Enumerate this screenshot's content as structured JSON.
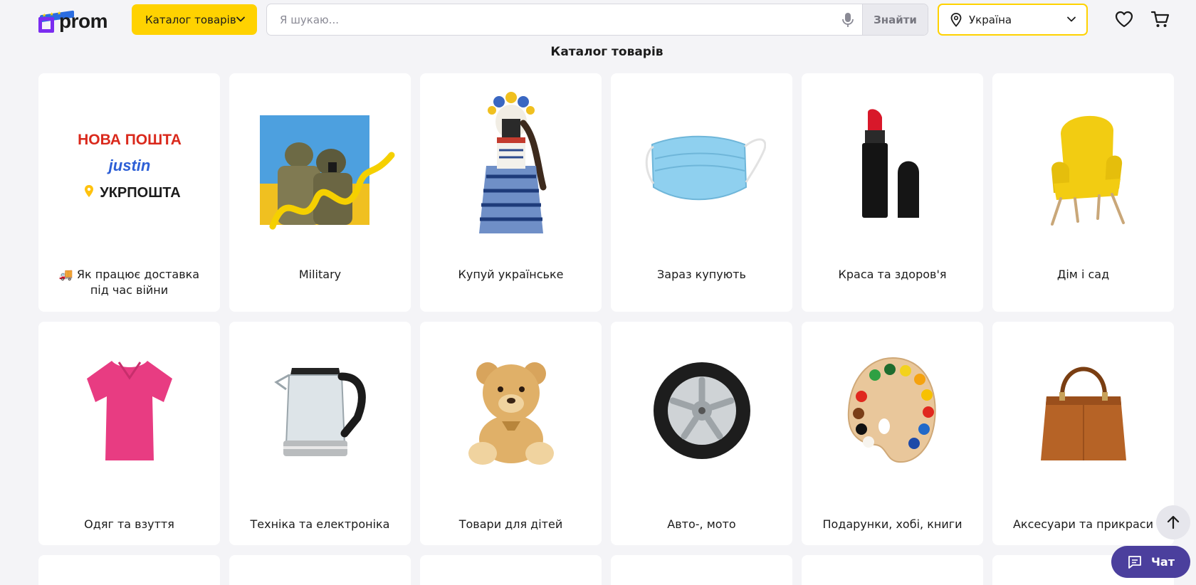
{
  "header": {
    "logo_text": "prom",
    "catalog_button_label": "Каталог товарів",
    "search": {
      "placeholder": "Я шукаю...",
      "value": "",
      "button_label": "Знайти"
    },
    "region": {
      "selected": "Україна"
    }
  },
  "page_title": "Каталог товарів",
  "categories": [
    {
      "label": "🚚 Як працює доставка під час війни",
      "icon": "delivery-logos-image"
    },
    {
      "label": "Military",
      "icon": "military-image"
    },
    {
      "label": "Купуй українське",
      "icon": "motanka-doll-image"
    },
    {
      "label": "Зараз купують",
      "icon": "face-mask-image"
    },
    {
      "label": "Краса та здоров'я",
      "icon": "lipstick-image"
    },
    {
      "label": "Дім і сад",
      "icon": "armchair-image"
    },
    {
      "label": "Одяг та взуття",
      "icon": "t-shirt-image"
    },
    {
      "label": "Техніка та електроніка",
      "icon": "kettle-image"
    },
    {
      "label": "Товари для дітей",
      "icon": "teddy-bear-image"
    },
    {
      "label": "Авто-, мото",
      "icon": "tire-image"
    },
    {
      "label": "Подарунки, хобі, книги",
      "icon": "paint-palette-image"
    },
    {
      "label": "Аксесуари та прикраси",
      "icon": "handbag-image"
    }
  ],
  "delivery_logos": {
    "nova_poshta": "НОВА ПОШТА",
    "justin": "justin",
    "ukrposhta": "УКРПОШТА"
  },
  "chat_button_label": "Чат",
  "colors": {
    "accent_yellow": "#ffd200",
    "brand_purple": "#7b2cf0",
    "chat_purple": "#4b3f9d",
    "background": "#f4f4f7"
  }
}
